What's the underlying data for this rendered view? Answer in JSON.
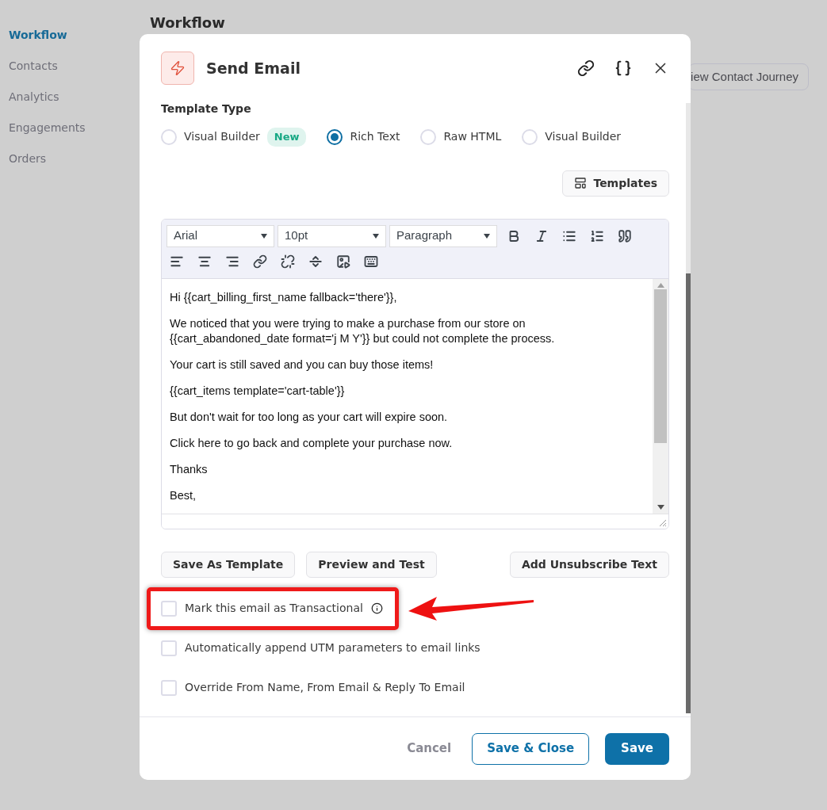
{
  "sidebar": {
    "items": [
      {
        "label": "Workflow",
        "selected": true
      },
      {
        "label": "Contacts",
        "selected": false
      },
      {
        "label": "Analytics",
        "selected": false
      },
      {
        "label": "Engagements",
        "selected": false
      },
      {
        "label": "Orders",
        "selected": false
      }
    ]
  },
  "page": {
    "title": "Workflow",
    "button": "iew Contact Journey"
  },
  "modal": {
    "title": "Send Email",
    "template_type": {
      "label": "Template Type",
      "options": [
        {
          "label": "Visual Builder",
          "selected": false,
          "badge": "New"
        },
        {
          "label": "Rich Text",
          "selected": true
        },
        {
          "label": "Raw HTML",
          "selected": false
        },
        {
          "label": "Visual Builder",
          "selected": false
        }
      ]
    },
    "templates_button": "Templates",
    "editor": {
      "font": "Arial",
      "size": "10pt",
      "block": "Paragraph",
      "paragraphs": [
        "Hi {{cart_billing_first_name fallback='there'}},",
        "We noticed that you were trying to make a purchase from our store on {{cart_abandoned_date format='j M Y'}} but could not complete the process.",
        "Your cart is still saved and you can buy those items!",
        "{{cart_items template='cart-table'}}",
        "But don't wait for too long as your cart will expire soon.",
        "Click here to go back and complete your purchase now.",
        "Thanks",
        "Best,"
      ]
    },
    "actions": [
      "Save As Template",
      "Preview and Test",
      "Add Unsubscribe Text"
    ],
    "options": [
      {
        "label": "Mark this email as Transactional",
        "checked": false,
        "info": true
      },
      {
        "label": "Automatically append UTM parameters to email links",
        "checked": false,
        "info": false
      },
      {
        "label": "Override From Name, From Email & Reply To Email",
        "checked": false,
        "info": false
      }
    ],
    "footer": [
      {
        "label": "Cancel",
        "kind": "text"
      },
      {
        "label": "Save & Close",
        "kind": "outline"
      },
      {
        "label": "Save",
        "kind": "primary"
      }
    ]
  }
}
